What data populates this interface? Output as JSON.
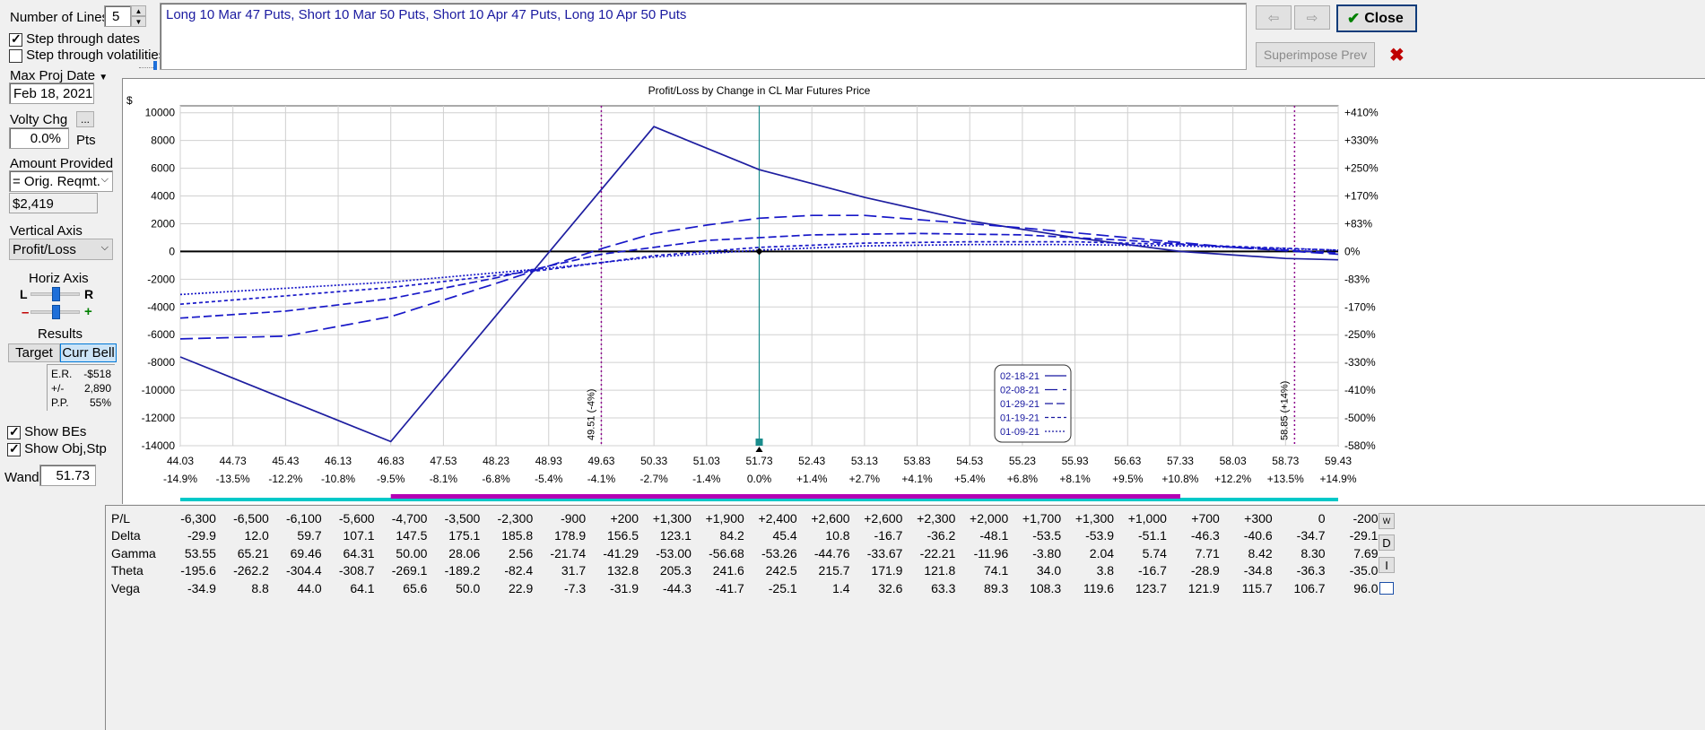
{
  "controls": {
    "number_of_lines_label": "Number of Lines",
    "number_of_lines_value": "5",
    "step_dates_label": "Step through dates",
    "step_vols_label": "Step through volatilities",
    "max_proj_date_label": "Max Proj Date",
    "max_proj_date_value": "Feb 18, 2021",
    "volty_chg_label": "Volty Chg",
    "volty_btn_label": "...",
    "volty_value": "0.0%",
    "volty_unit": "Pts",
    "amount_label": "Amount Provided",
    "amount_select": "= Orig. Reqmt.",
    "amount_value": "$2,419",
    "vertical_axis_label": "Vertical Axis",
    "vertical_axis_select": "Profit/Loss",
    "horiz_axis_label": "Horiz Axis",
    "left_label": "L",
    "right_label": "R",
    "minus_label": "–",
    "plus_label": "+",
    "results_label": "Results",
    "target_tab": "Target",
    "curr_bell_tab": "Curr Bell",
    "er_label": "E.R.",
    "er_value": "-$518",
    "pm_label": "+/-",
    "pm_value": "2,890",
    "pp_label": "P.P.",
    "pp_value": "55%",
    "show_bes_label": "Show BEs",
    "show_obj_label": "Show Obj,Stp",
    "wand_label": "Wand",
    "wand_value": "51.73"
  },
  "position_text": "Long 10 Mar 47 Puts, Short 10 Mar 50 Puts, Short 10 Apr 47 Puts, Long 10 Apr 50 Puts",
  "top_right": {
    "close_label": "Close",
    "superimpose_label": "Superimpose Prev"
  },
  "table": {
    "rows": [
      {
        "name": "P/L",
        "values": [
          "-6,300",
          "-6,500",
          "-6,100",
          "-5,600",
          "-4,700",
          "-3,500",
          "-2,300",
          "-900",
          "+200",
          "+1,300",
          "+1,900",
          "+2,400",
          "+2,600",
          "+2,600",
          "+2,300",
          "+2,000",
          "+1,700",
          "+1,300",
          "+1,000",
          "+700",
          "+300",
          "0",
          "-200"
        ]
      },
      {
        "name": "Delta",
        "values": [
          "-29.9",
          "12.0",
          "59.7",
          "107.1",
          "147.5",
          "175.1",
          "185.8",
          "178.9",
          "156.5",
          "123.1",
          "84.2",
          "45.4",
          "10.8",
          "-16.7",
          "-36.2",
          "-48.1",
          "-53.5",
          "-53.9",
          "-51.1",
          "-46.3",
          "-40.6",
          "-34.7",
          "-29.1"
        ]
      },
      {
        "name": "Gamma",
        "values": [
          "53.55",
          "65.21",
          "69.46",
          "64.31",
          "50.00",
          "28.06",
          "2.56",
          "-21.74",
          "-41.29",
          "-53.00",
          "-56.68",
          "-53.26",
          "-44.76",
          "-33.67",
          "-22.21",
          "-11.96",
          "-3.80",
          "2.04",
          "5.74",
          "7.71",
          "8.42",
          "8.30",
          "7.69"
        ]
      },
      {
        "name": "Theta",
        "values": [
          "-195.6",
          "-262.2",
          "-304.4",
          "-308.7",
          "-269.1",
          "-189.2",
          "-82.4",
          "31.7",
          "132.8",
          "205.3",
          "241.6",
          "242.5",
          "215.7",
          "171.9",
          "121.8",
          "74.1",
          "34.0",
          "3.8",
          "-16.7",
          "-28.9",
          "-34.8",
          "-36.3",
          "-35.0"
        ]
      },
      {
        "name": "Vega",
        "values": [
          "-34.9",
          "8.8",
          "44.0",
          "64.1",
          "65.6",
          "50.0",
          "22.9",
          "-7.3",
          "-31.9",
          "-44.3",
          "-41.7",
          "-25.1",
          "1.4",
          "32.6",
          "63.3",
          "89.3",
          "108.3",
          "119.6",
          "123.7",
          "121.9",
          "115.7",
          "106.7",
          "96.0"
        ]
      }
    ],
    "side_buttons": [
      "W",
      "D",
      "I"
    ]
  },
  "chart_data": {
    "type": "line",
    "title": "Profit/Loss by Change in CL Mar Futures Price",
    "ylabel": "$",
    "x_ticks": [
      "44.03",
      "44.73",
      "45.43",
      "46.13",
      "46.83",
      "47.53",
      "48.23",
      "48.93",
      "49.63",
      "50.33",
      "51.03",
      "51.73",
      "52.43",
      "53.13",
      "53.83",
      "54.53",
      "55.23",
      "55.93",
      "56.63",
      "57.33",
      "58.03",
      "58.73",
      "59.43"
    ],
    "x_pct_ticks": [
      "-14.9%",
      "-13.5%",
      "-12.2%",
      "-10.8%",
      "-9.5%",
      "-8.1%",
      "-6.8%",
      "-5.4%",
      "-4.1%",
      "-2.7%",
      "-1.4%",
      "0.0%",
      "+1.4%",
      "+2.7%",
      "+4.1%",
      "+5.4%",
      "+6.8%",
      "+8.1%",
      "+9.5%",
      "+10.8%",
      "+12.2%",
      "+13.5%",
      "+14.9%"
    ],
    "y_ticks": [
      10000,
      8000,
      6000,
      4000,
      2000,
      0,
      -2000,
      -4000,
      -6000,
      -8000,
      -10000,
      -12000,
      -14000
    ],
    "y_right_ticks": [
      "+410%",
      "+330%",
      "+250%",
      "+170%",
      "+83%",
      "0%",
      "-83%",
      "-170%",
      "-250%",
      "-330%",
      "-410%",
      "-500%",
      "-580%"
    ],
    "xlim": [
      44.03,
      59.43
    ],
    "ylim": [
      -14000,
      10500
    ],
    "current_price": 51.73,
    "current_value": 0,
    "breakevens": [
      {
        "x": 49.63,
        "label": "49.51 (-4%)"
      },
      {
        "x": 58.85,
        "label": "58.85 (+14%)"
      }
    ],
    "series": [
      {
        "name": "02-18-21",
        "dash": "solid",
        "x": [
          44.03,
          46.83,
          50.33,
          51.73,
          53.13,
          54.53,
          55.93,
          57.33,
          58.73,
          59.43
        ],
        "values": [
          -7600,
          -13700,
          9000,
          5900,
          3900,
          2200,
          1000,
          0,
          -500,
          -600
        ]
      },
      {
        "name": "02-08-21",
        "dash": "long",
        "x": [
          44.03,
          45.43,
          46.83,
          48.23,
          49.63,
          50.33,
          51.03,
          51.73,
          52.43,
          53.13,
          53.83,
          55.23,
          56.63,
          58.03,
          59.43
        ],
        "values": [
          -6300,
          -6100,
          -4700,
          -2300,
          200,
          1300,
          1900,
          2400,
          2600,
          2600,
          2300,
          1700,
          1000,
          300,
          -200
        ]
      },
      {
        "name": "01-29-21",
        "dash": "mid",
        "x": [
          44.03,
          45.43,
          46.83,
          48.23,
          49.63,
          51.03,
          52.43,
          53.83,
          55.23,
          56.63,
          58.03,
          59.43
        ],
        "values": [
          -4800,
          -4300,
          -3400,
          -1900,
          -200,
          800,
          1200,
          1300,
          1200,
          800,
          300,
          -100
        ]
      },
      {
        "name": "01-19-21",
        "dash": "short",
        "x": [
          44.03,
          46.83,
          48.93,
          50.33,
          51.73,
          53.13,
          54.53,
          55.93,
          57.33,
          59.43
        ],
        "values": [
          -3800,
          -2600,
          -1300,
          -300,
          300,
          600,
          700,
          700,
          500,
          100
        ]
      },
      {
        "name": "01-09-21",
        "dash": "dot",
        "x": [
          44.03,
          46.83,
          48.93,
          50.33,
          51.73,
          53.13,
          54.53,
          55.93,
          57.33,
          59.43
        ],
        "values": [
          -3100,
          -2200,
          -1200,
          -400,
          100,
          400,
          500,
          500,
          400,
          100
        ]
      }
    ],
    "colors": {
      "accent": "#1e1ea0",
      "series": "#1818c8",
      "breakeven": "#8b008b",
      "cursor": "#1a8c8c",
      "obj_bar": "#b400b4",
      "stp_bar": "#00c8c8"
    }
  }
}
